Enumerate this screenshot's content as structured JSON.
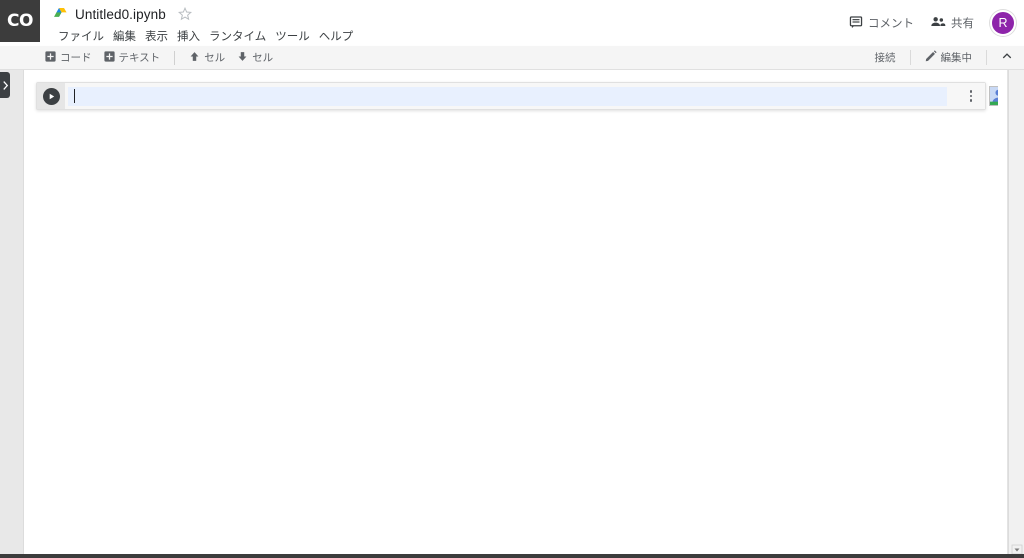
{
  "app": {
    "logo_text": "CO",
    "logo_name": "colab-logo"
  },
  "header": {
    "doc_title": "Untitled0.ipynb",
    "drive_icon": "google-drive-icon",
    "star_icon": "star-outline-icon",
    "menu_items": [
      {
        "label": "ファイル",
        "name": "menu-file"
      },
      {
        "label": "編集",
        "name": "menu-edit"
      },
      {
        "label": "表示",
        "name": "menu-view"
      },
      {
        "label": "挿入",
        "name": "menu-insert"
      },
      {
        "label": "ランタイム",
        "name": "menu-runtime"
      },
      {
        "label": "ツール",
        "name": "menu-tools"
      },
      {
        "label": "ヘルプ",
        "name": "menu-help"
      }
    ],
    "comment_label": "コメント",
    "comment_icon": "comment-icon",
    "share_label": "共有",
    "share_icon": "people-icon",
    "avatar_initial": "R",
    "avatar_color": "#8e24aa"
  },
  "toolbar": {
    "add_code_label": "コード",
    "add_code_icon": "plus-box-icon",
    "add_text_label": "テキスト",
    "add_text_icon": "plus-box-icon",
    "move_up_label": "セル",
    "move_up_icon": "arrow-up-icon",
    "move_down_label": "セル",
    "move_down_icon": "arrow-down-icon",
    "connect_label": "接続",
    "editing_label": "編集中",
    "editing_icon": "pencil-icon",
    "collapse_icon": "chevron-up-icon"
  },
  "sidebar": {
    "expand_icon": "chevron-right-icon"
  },
  "notebook": {
    "cells": [
      {
        "type": "code",
        "run_icon": "play-icon",
        "content": "",
        "menu_icon": "more-vert-icon",
        "avatar_icon": "person-avatar-icon"
      }
    ]
  },
  "scrollbar": {
    "down_arrow_icon": "scroll-down-arrow-icon"
  },
  "colors": {
    "accent": "#4285f4",
    "cell_active_line": "#e8f0fe",
    "cell_bg": "#f7f7f7",
    "chrome_dark": "#3c3c3c"
  }
}
